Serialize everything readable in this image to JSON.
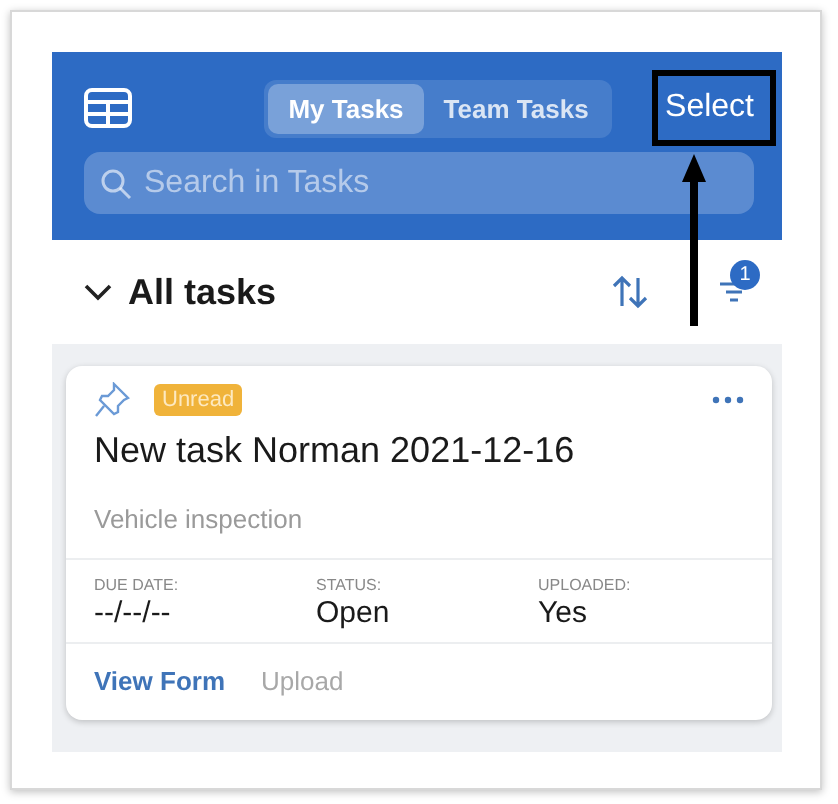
{
  "header": {
    "tabs": [
      {
        "label": "My Tasks",
        "selected": true
      },
      {
        "label": "Team Tasks",
        "selected": false
      }
    ],
    "select_button": "Select",
    "search": {
      "placeholder": "Search in Tasks"
    }
  },
  "list_header": {
    "title": "All tasks",
    "expanded": true,
    "filter_count": "1"
  },
  "tasks": [
    {
      "pinned": false,
      "badge": "Unread",
      "title": "New task Norman 2021-12-16",
      "form": "Vehicle inspection",
      "fields": [
        {
          "label": "DUE DATE:",
          "value": "--/--/--"
        },
        {
          "label": "STATUS:",
          "value": "Open"
        },
        {
          "label": "UPLOADED:",
          "value": "Yes"
        }
      ],
      "actions": [
        {
          "label": "View Form",
          "disabled": false
        },
        {
          "label": "Upload",
          "disabled": true
        }
      ]
    }
  ]
}
